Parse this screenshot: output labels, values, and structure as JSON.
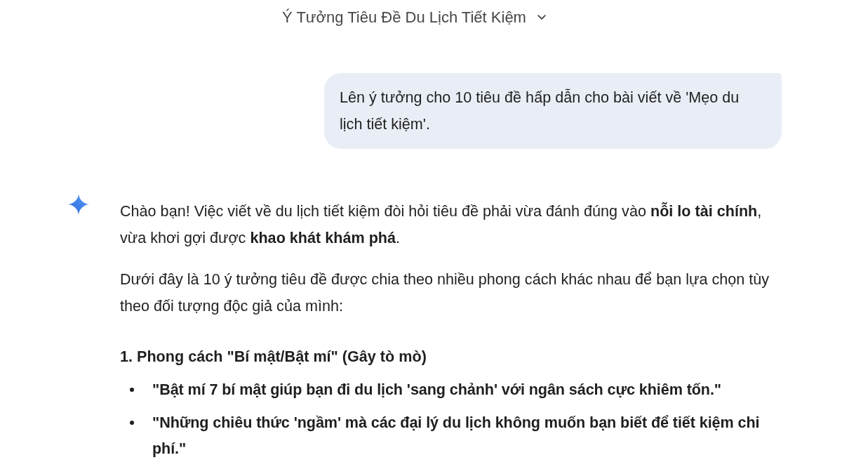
{
  "header": {
    "title": "Ý Tưởng Tiêu Đề Du Lịch Tiết Kiệm"
  },
  "conversation": {
    "user_message": {
      "text": "Lên ý tưởng cho 10 tiêu đề hấp dẫn cho bài viết về 'Mẹo du lịch tiết kiệm'."
    },
    "response": {
      "paragraphs": [
        "Chào bạn! Việc viết về du lịch tiết kiệm đòi hỏi tiêu đề phải vừa đánh đúng vào **nỗi lo tài chính**, vừa khơi gợi được **khao khát khám phá**.",
        "Dưới đây là 10 ý tưởng tiêu đề được chia theo nhiều phong cách khác nhau để bạn lựa chọn tùy theo đối tượng độc giả của mình:"
      ],
      "sections": [
        {
          "heading": "1. Phong cách \"Bí mật/Bật mí\" (Gây tò mò)",
          "bullets": [
            "\"Bật mí 7 bí mật giúp bạn đi du lịch 'sang chảnh' với ngân sách cực khiêm tốn.\"",
            "\"Những chiêu thức 'ngầm' mà các đại lý du lịch không muốn bạn biết để tiết kiệm chi phí.\""
          ]
        }
      ]
    }
  }
}
